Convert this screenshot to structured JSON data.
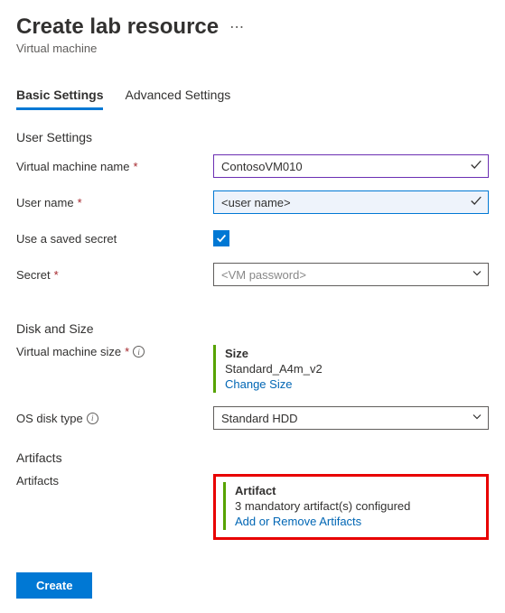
{
  "header": {
    "title": "Create lab resource",
    "subtitle": "Virtual machine"
  },
  "tabs": {
    "basic": "Basic Settings",
    "advanced": "Advanced Settings"
  },
  "sections": {
    "user_settings": "User Settings",
    "disk_size": "Disk and Size",
    "artifacts": "Artifacts"
  },
  "fields": {
    "vm_name": {
      "label": "Virtual machine name",
      "value": "ContosoVM010"
    },
    "user_name": {
      "label": "User name",
      "value": "<user name>"
    },
    "saved_secret": {
      "label": "Use a saved secret"
    },
    "secret": {
      "label": "Secret",
      "placeholder": "<VM password>"
    },
    "vm_size": {
      "label": "Virtual machine size",
      "heading": "Size",
      "value": "Standard_A4m_v2",
      "link": "Change Size"
    },
    "os_disk": {
      "label": "OS disk type",
      "value": "Standard HDD"
    },
    "artifacts": {
      "label": "Artifacts",
      "heading": "Artifact",
      "status": "3 mandatory artifact(s) configured",
      "link": "Add or Remove Artifacts"
    }
  },
  "buttons": {
    "create": "Create"
  }
}
